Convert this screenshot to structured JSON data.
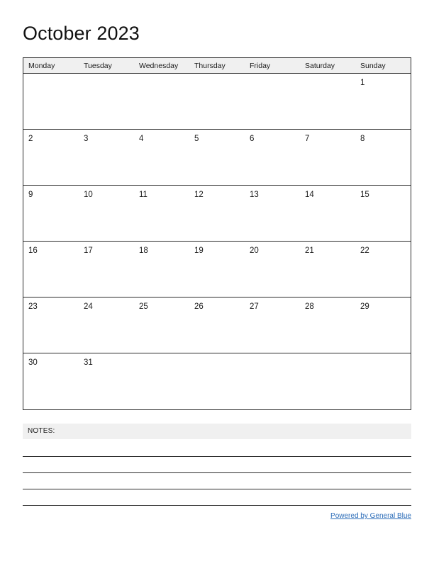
{
  "document": {
    "title": "October 2023",
    "month": "October",
    "year": "2023"
  },
  "calendar": {
    "weekday_headers": [
      "Monday",
      "Tuesday",
      "Wednesday",
      "Thursday",
      "Friday",
      "Saturday",
      "Sunday"
    ],
    "weeks": [
      [
        "",
        "",
        "",
        "",
        "",
        "",
        "1"
      ],
      [
        "2",
        "3",
        "4",
        "5",
        "6",
        "7",
        "8"
      ],
      [
        "9",
        "10",
        "11",
        "12",
        "13",
        "14",
        "15"
      ],
      [
        "16",
        "17",
        "18",
        "19",
        "20",
        "21",
        "22"
      ],
      [
        "23",
        "24",
        "25",
        "26",
        "27",
        "28",
        "29"
      ],
      [
        "30",
        "31",
        "",
        "",
        "",
        "",
        ""
      ]
    ]
  },
  "notes": {
    "label": "NOTES:",
    "line_count": 4
  },
  "footer": {
    "link_text": "Powered by General Blue"
  },
  "colors": {
    "header_background": "#f0f0f0",
    "grid_border": "#2b2b2b",
    "text": "#1a1a1a",
    "link": "#2b6cb8",
    "page_background": "#ffffff"
  }
}
